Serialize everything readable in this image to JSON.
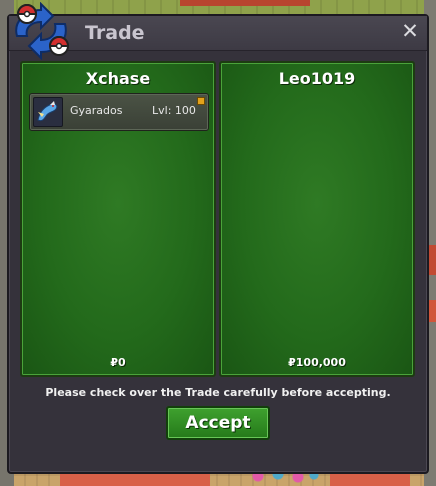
{
  "window": {
    "title": "Trade",
    "close_label": "✕"
  },
  "left_panel": {
    "player": "Xchase",
    "items": [
      {
        "name": "Gyarados",
        "level": "Lvl: 100"
      }
    ],
    "money": "₽0"
  },
  "right_panel": {
    "player": "Leo1019",
    "items": [],
    "money": "₽100,000"
  },
  "notice": "Please check over the Trade carefully before accepting.",
  "accept_label": "Accept",
  "icons": {
    "window_icon": "trade-arrows-pokeball-icon",
    "close": "close-icon",
    "item": "gyarados-sprite-icon",
    "item_badge": "item-marker-icon"
  },
  "colors": {
    "panel_green": "#236a1b",
    "accept_green": "#2f8c23",
    "window_bg": "#35323b",
    "title_text": "#c9c5cf"
  }
}
